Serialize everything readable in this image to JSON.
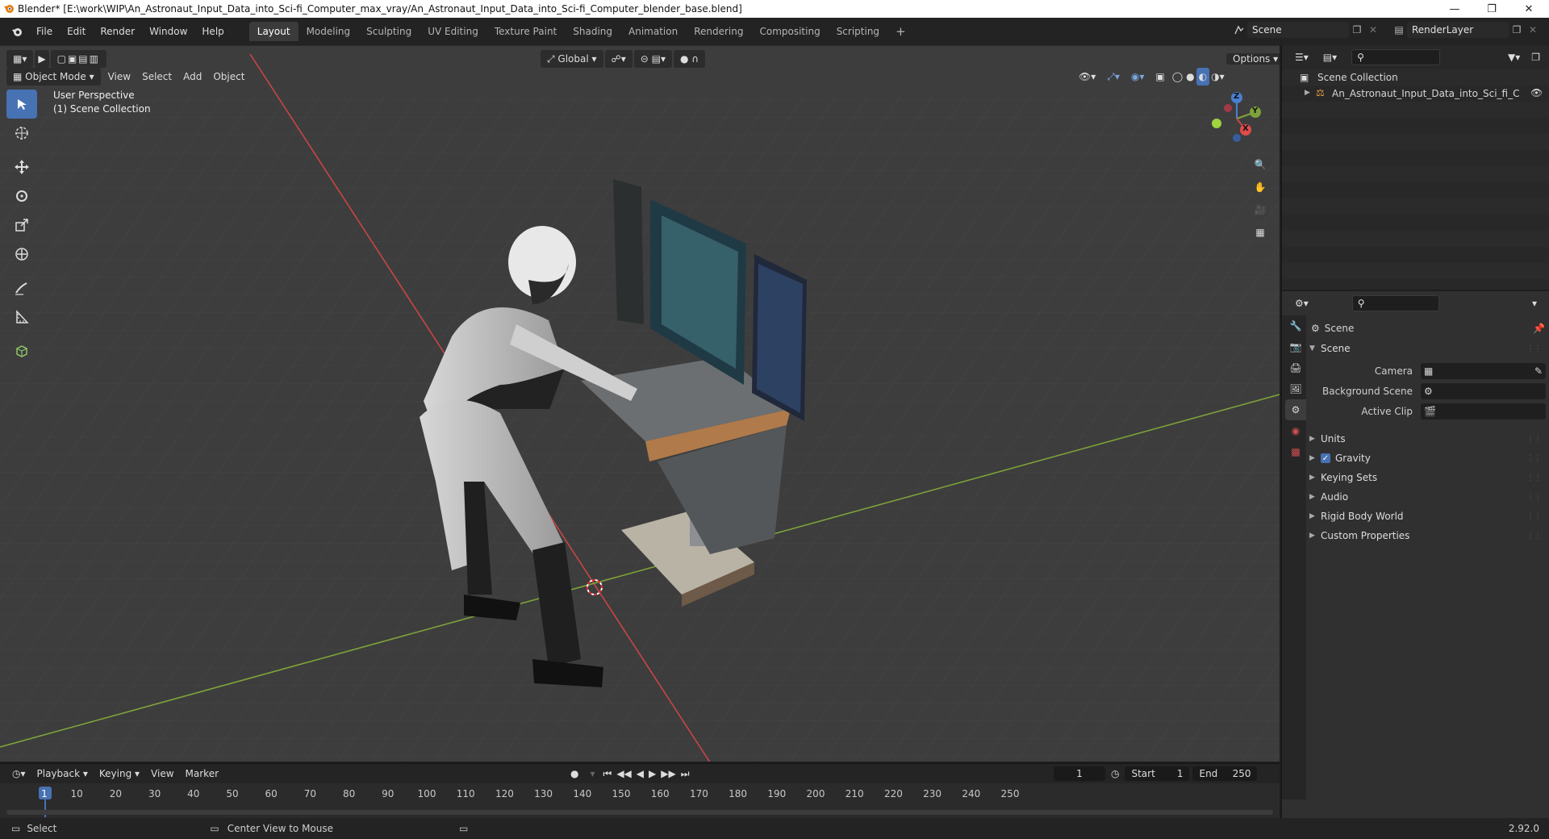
{
  "window": {
    "title": "Blender* [E:\\work\\WIP\\An_Astronaut_Input_Data_into_Sci-fi_Computer_max_vray/An_Astronaut_Input_Data_into_Sci-fi_Computer_blender_base.blend]",
    "controls": [
      "minimize-icon",
      "restore-icon",
      "close-icon"
    ]
  },
  "menubar": {
    "items": [
      "File",
      "Edit",
      "Render",
      "Window",
      "Help"
    ],
    "workspaces": [
      "Layout",
      "Modeling",
      "Sculpting",
      "UV Editing",
      "Texture Paint",
      "Shading",
      "Animation",
      "Rendering",
      "Compositing",
      "Scripting"
    ],
    "active_workspace": "Layout",
    "scene": "Scene",
    "view_layer": "RenderLayer"
  },
  "viewport": {
    "mode": "Object Mode",
    "menus": [
      "View",
      "Select",
      "Add",
      "Object"
    ],
    "transform_orientation": "Global",
    "options": "Options",
    "overlay_title": "User Perspective",
    "overlay_subtitle": "(1) Scene Collection",
    "gizmo_axes": {
      "z": "Z",
      "y": "Y",
      "x": "X"
    },
    "tools": [
      "select-box-icon",
      "cursor-icon",
      "move-icon",
      "rotate-icon",
      "scale-icon",
      "transform-icon",
      "annotate-icon",
      "measure-icon",
      "add-cube-icon"
    ]
  },
  "outliner": {
    "root": "Scene Collection",
    "items": [
      {
        "name": "An_Astronaut_Input_Data_into_Sci_fi_Compu",
        "icon": "empty-object-icon"
      }
    ]
  },
  "properties": {
    "context": "Scene",
    "panel": "Scene",
    "rows": [
      {
        "label": "Camera"
      },
      {
        "label": "Background Scene"
      },
      {
        "label": "Active Clip"
      }
    ],
    "subpanels": [
      {
        "label": "Units",
        "checkbox": false
      },
      {
        "label": "Gravity",
        "checkbox": true
      },
      {
        "label": "Keying Sets",
        "checkbox": false
      },
      {
        "label": "Audio",
        "checkbox": false
      },
      {
        "label": "Rigid Body World",
        "checkbox": false
      },
      {
        "label": "Custom Properties",
        "checkbox": false
      }
    ]
  },
  "timeline": {
    "menus": [
      "Playback",
      "Keying",
      "View",
      "Marker"
    ],
    "current_frame": "1",
    "start_label": "Start",
    "start": "1",
    "end_label": "End",
    "end": "250",
    "ruler_labels": [
      "1",
      "10",
      "20",
      "30",
      "40",
      "50",
      "60",
      "70",
      "80",
      "90",
      "100",
      "110",
      "120",
      "130",
      "140",
      "150",
      "160",
      "170",
      "180",
      "190",
      "200",
      "210",
      "220",
      "230",
      "240",
      "250"
    ]
  },
  "statusbar": {
    "left": "Select",
    "middle": "Center View to Mouse",
    "version": "2.92.0"
  },
  "colors": {
    "accent": "#4772b3",
    "viewport_bg": "#3f3f3f",
    "x_axis": "#c84545",
    "y_axis": "#7ea23a"
  }
}
